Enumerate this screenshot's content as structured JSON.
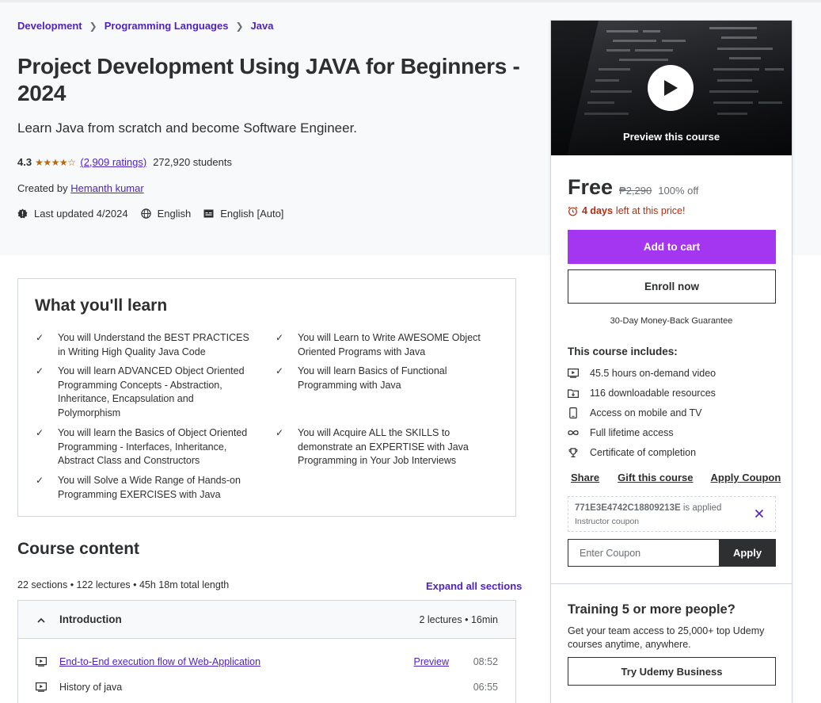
{
  "breadcrumb": [
    "Development",
    "Programming Languages",
    "Java"
  ],
  "course": {
    "title": "Project Development Using JAVA for Beginners - 2024",
    "subtitle": "Learn Java from scratch and become Software Engineer.",
    "rating": "4.3",
    "stars": "★★★★☆",
    "ratings_count": "(2,909 ratings)",
    "students": "272,920 students",
    "created_by_label": "Created by",
    "instructor": "Hemanth kumar",
    "last_updated": "Last updated 4/2024",
    "language": "English",
    "captions": "English [Auto]"
  },
  "learn": {
    "title": "What you'll learn",
    "items": [
      "You will Understand the BEST PRACTICES in Writing High Quality Java Code",
      "You will Learn to Write AWESOME Object Oriented Programs with Java",
      "You will learn ADVANCED Object Oriented Programming Concepts - Abstraction, Inheritance, Encapsulation and Polymorphism",
      "You will learn Basics of Functional Programming with Java",
      "You will learn the Basics of Object Oriented Programming - Interfaces, Inheritance, Abstract Class and Constructors",
      "You will Acquire ALL the SKILLS to demonstrate an EXPERTISE with Java Programming in Your Job Interviews",
      "You will Solve a Wide Range of Hands-on Programming EXERCISES with Java"
    ]
  },
  "content": {
    "title": "Course content",
    "summary": "22 sections • 122 lectures • 45h 18m total length",
    "expand_all": "Expand all sections",
    "section": {
      "title": "Introduction",
      "meta": "2 lectures • 16min"
    },
    "lectures": [
      {
        "title": "End-to-End execution flow of Web-Application",
        "preview": "Preview",
        "duration": "08:52"
      },
      {
        "title": "History of java",
        "preview": "",
        "duration": "06:55"
      }
    ]
  },
  "sidebar": {
    "preview_label": "Preview this course",
    "price": "Free",
    "original_price": "₱2,290",
    "discount": "100% off",
    "days_left_bold": "4 days",
    "days_left_rest": "left at this price!",
    "add_to_cart": "Add to cart",
    "enroll_now": "Enroll now",
    "guarantee": "30-Day Money-Back Guarantee",
    "includes_title": "This course includes:",
    "includes": [
      {
        "icon": "video-icon",
        "text": "45.5 hours on-demand video"
      },
      {
        "icon": "download-icon",
        "text": "116 downloadable resources"
      },
      {
        "icon": "mobile-icon",
        "text": "Access on mobile and TV"
      },
      {
        "icon": "infinity-icon",
        "text": "Full lifetime access"
      },
      {
        "icon": "trophy-icon",
        "text": "Certificate of completion"
      }
    ],
    "share": "Share",
    "gift": "Gift this course",
    "apply_coupon": "Apply Coupon",
    "coupon_code": "771E3E4742C18809213E",
    "coupon_applied": "is applied",
    "coupon_type": "Instructor coupon",
    "coupon_placeholder": "Enter Coupon",
    "apply": "Apply",
    "training_title": "Training 5 or more people?",
    "training_desc": "Get your team access to 25,000+ top Udemy courses anytime, anywhere.",
    "business_button": "Try Udemy Business"
  },
  "colors": {
    "accent_purple": "#a435f0",
    "link_purple": "#5022c3",
    "star_orange": "#b4690e",
    "urgency_red": "#b32d0f",
    "dark": "#2d2f31"
  }
}
